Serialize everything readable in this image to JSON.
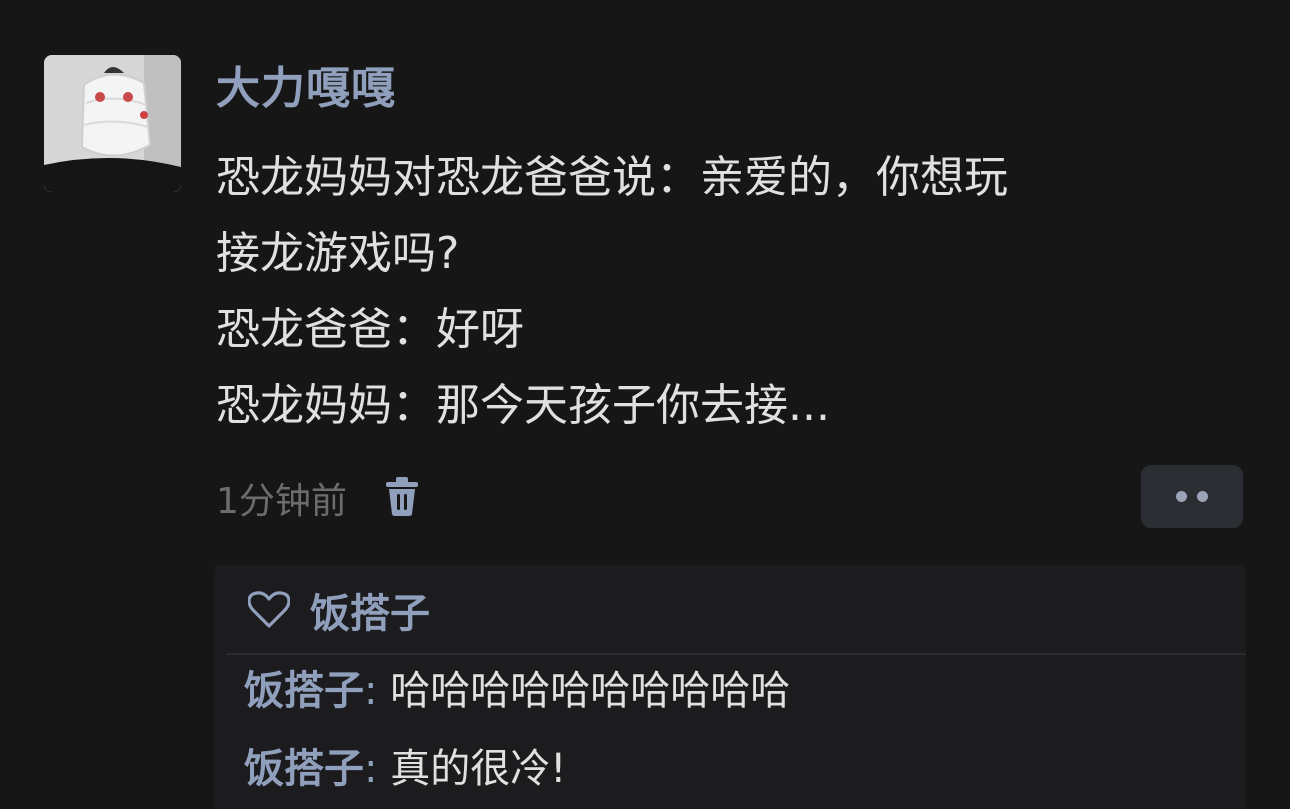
{
  "post": {
    "username": "大力嘎嘎",
    "lines": [
      "恐龙妈妈对恐龙爸爸说：亲爱的，你想玩",
      "接龙游戏吗?",
      "恐龙爸爸：好呀",
      "恐龙妈妈：那今天孩子你去接..."
    ],
    "time": "1分钟前",
    "icons": {
      "delete": "trash-icon",
      "more": "more-dots-icon",
      "like": "heart-icon"
    }
  },
  "likes": {
    "names": "饭搭子"
  },
  "replies": [
    {
      "author": "饭搭子",
      "separator": ": ",
      "text": "哈哈哈哈哈哈哈哈哈哈"
    },
    {
      "author": "饭搭子",
      "separator": ": ",
      "text": "真的很冷!"
    }
  ],
  "colors": {
    "background": "#161616",
    "accent_name": "#8f9fbc",
    "body_text": "#e0e0e0",
    "muted_text": "#6c6c6c"
  }
}
